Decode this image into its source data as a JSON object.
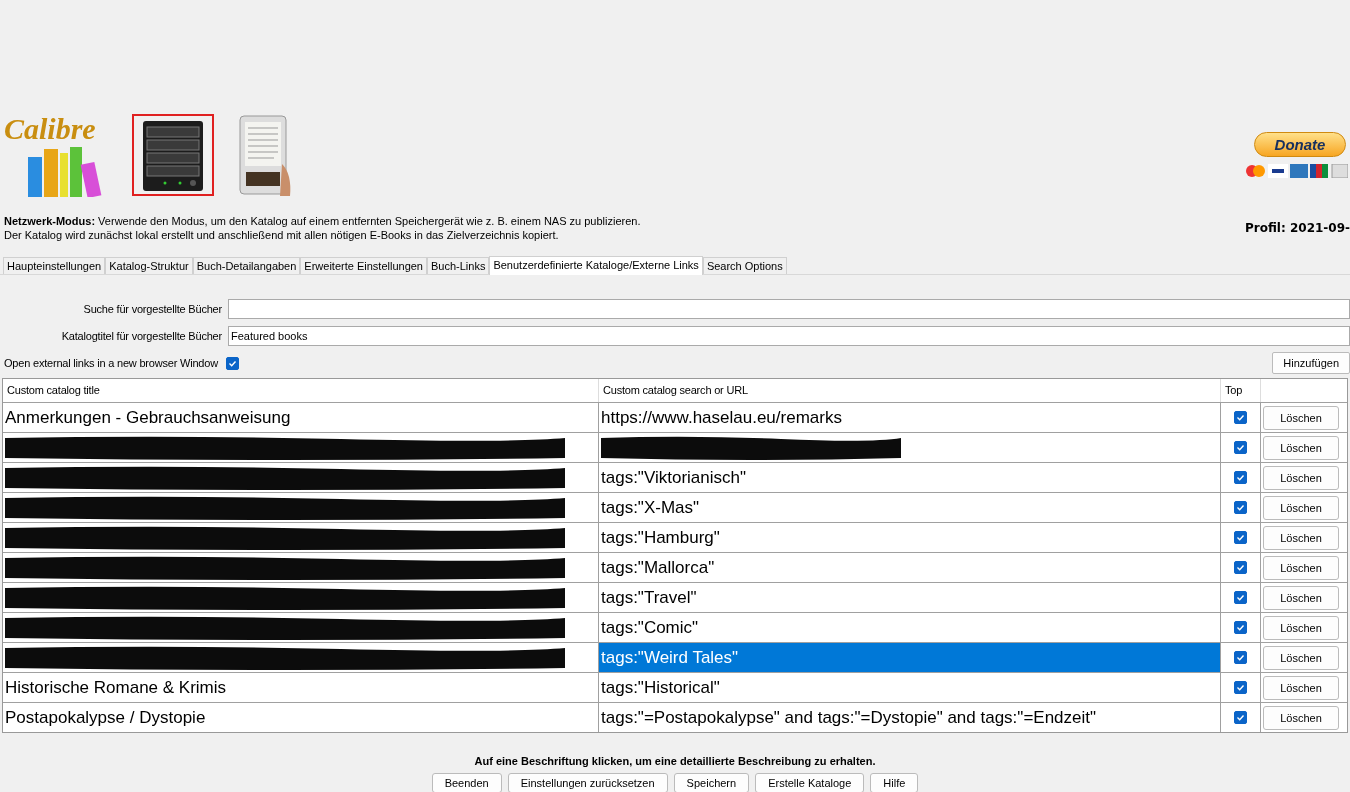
{
  "header": {
    "logo_text": "Calibre",
    "modes": [
      {
        "kind": "nas",
        "selected": true
      },
      {
        "kind": "reader",
        "selected": false
      }
    ],
    "donate": "Donate",
    "profile": "Profil: 2021-09-"
  },
  "description": {
    "text": "**Netzwerk-Modus:** Verwende den Modus, um den Katalog auf einem entfernten Speichergerät wie z. B. einem NAS zu publizieren.",
    "text2": "Der Katalog wird zunächst lokal erstellt und anschließend mit allen nötigen E-Books in das Zielverzeichnis kopiert."
  },
  "tabs": [
    {
      "label": "Haupteinstellungen",
      "selected": false
    },
    {
      "label": "Katalog-Struktur",
      "selected": false
    },
    {
      "label": "Buch-Detailangaben",
      "selected": false
    },
    {
      "label": "Erweiterte Einstellungen",
      "selected": false
    },
    {
      "label": "Buch-Links",
      "selected": false
    },
    {
      "label": "Benutzerdefinierte Kataloge/Externe Links",
      "selected": true
    },
    {
      "label": "Search Options",
      "selected": false
    }
  ],
  "form": {
    "search_label": "Suche für vorgestellte Bücher",
    "title_label": "Katalogtitel für vorgestellte Bücher",
    "title_value": "Featured books",
    "external_label": "Open external links in a new browser Window",
    "external_checked": true,
    "add_button": "Hinzufügen"
  },
  "table": {
    "columns": [
      "Custom catalog title",
      "Custom catalog search or URL",
      "Top"
    ],
    "rows": [
      {
        "title": "Anmerkungen - Gebrauchsanweisung",
        "url": "https://www.haselau.eu/remarks",
        "top": true,
        "selected": false,
        "delete": "Löschen"
      },
      {
        "title_redacted": true,
        "url_redacted": true,
        "top": true,
        "selected": false,
        "delete": "Löschen"
      },
      {
        "title_redacted": true,
        "url": "tags:\"Viktorianisch\"",
        "top": true,
        "selected": false,
        "delete": "Löschen"
      },
      {
        "title_redacted": true,
        "url": "tags:\"X-Mas\"",
        "top": true,
        "selected": false,
        "delete": "Löschen"
      },
      {
        "title_redacted": true,
        "url": "tags:\"Hamburg\"",
        "top": true,
        "selected": false,
        "delete": "Löschen"
      },
      {
        "title_redacted": true,
        "url": "tags:\"Mallorca\"",
        "top": true,
        "selected": false,
        "delete": "Löschen"
      },
      {
        "title_redacted": true,
        "url": "tags:\"Travel\"",
        "top": true,
        "selected": false,
        "delete": "Löschen"
      },
      {
        "title_redacted": true,
        "url": "tags:\"Comic\"",
        "top": true,
        "selected": false,
        "delete": "Löschen"
      },
      {
        "title_redacted": true,
        "url": "tags:\"Weird Tales\"",
        "top": true,
        "selected": true,
        "delete": "Löschen"
      },
      {
        "title": "Historische Romane & Krimis",
        "url": "tags:\"Historical\"",
        "top": true,
        "selected": false,
        "delete": "Löschen"
      },
      {
        "title": "Postapokalypse / Dystopie",
        "url": "tags:\"=Postapokalypse\" and tags:\"=Dystopie\" and tags:\"=Endzeit\"",
        "top": true,
        "selected": false,
        "delete": "Löschen"
      }
    ]
  },
  "hint": "Auf eine Beschriftung klicken, um eine detaillierte Beschreibung zu erhalten.",
  "buttons": [
    "Beenden",
    "Einstellungen zurücksetzen",
    "Speichern",
    "Erstelle Kataloge",
    "Hilfe"
  ]
}
